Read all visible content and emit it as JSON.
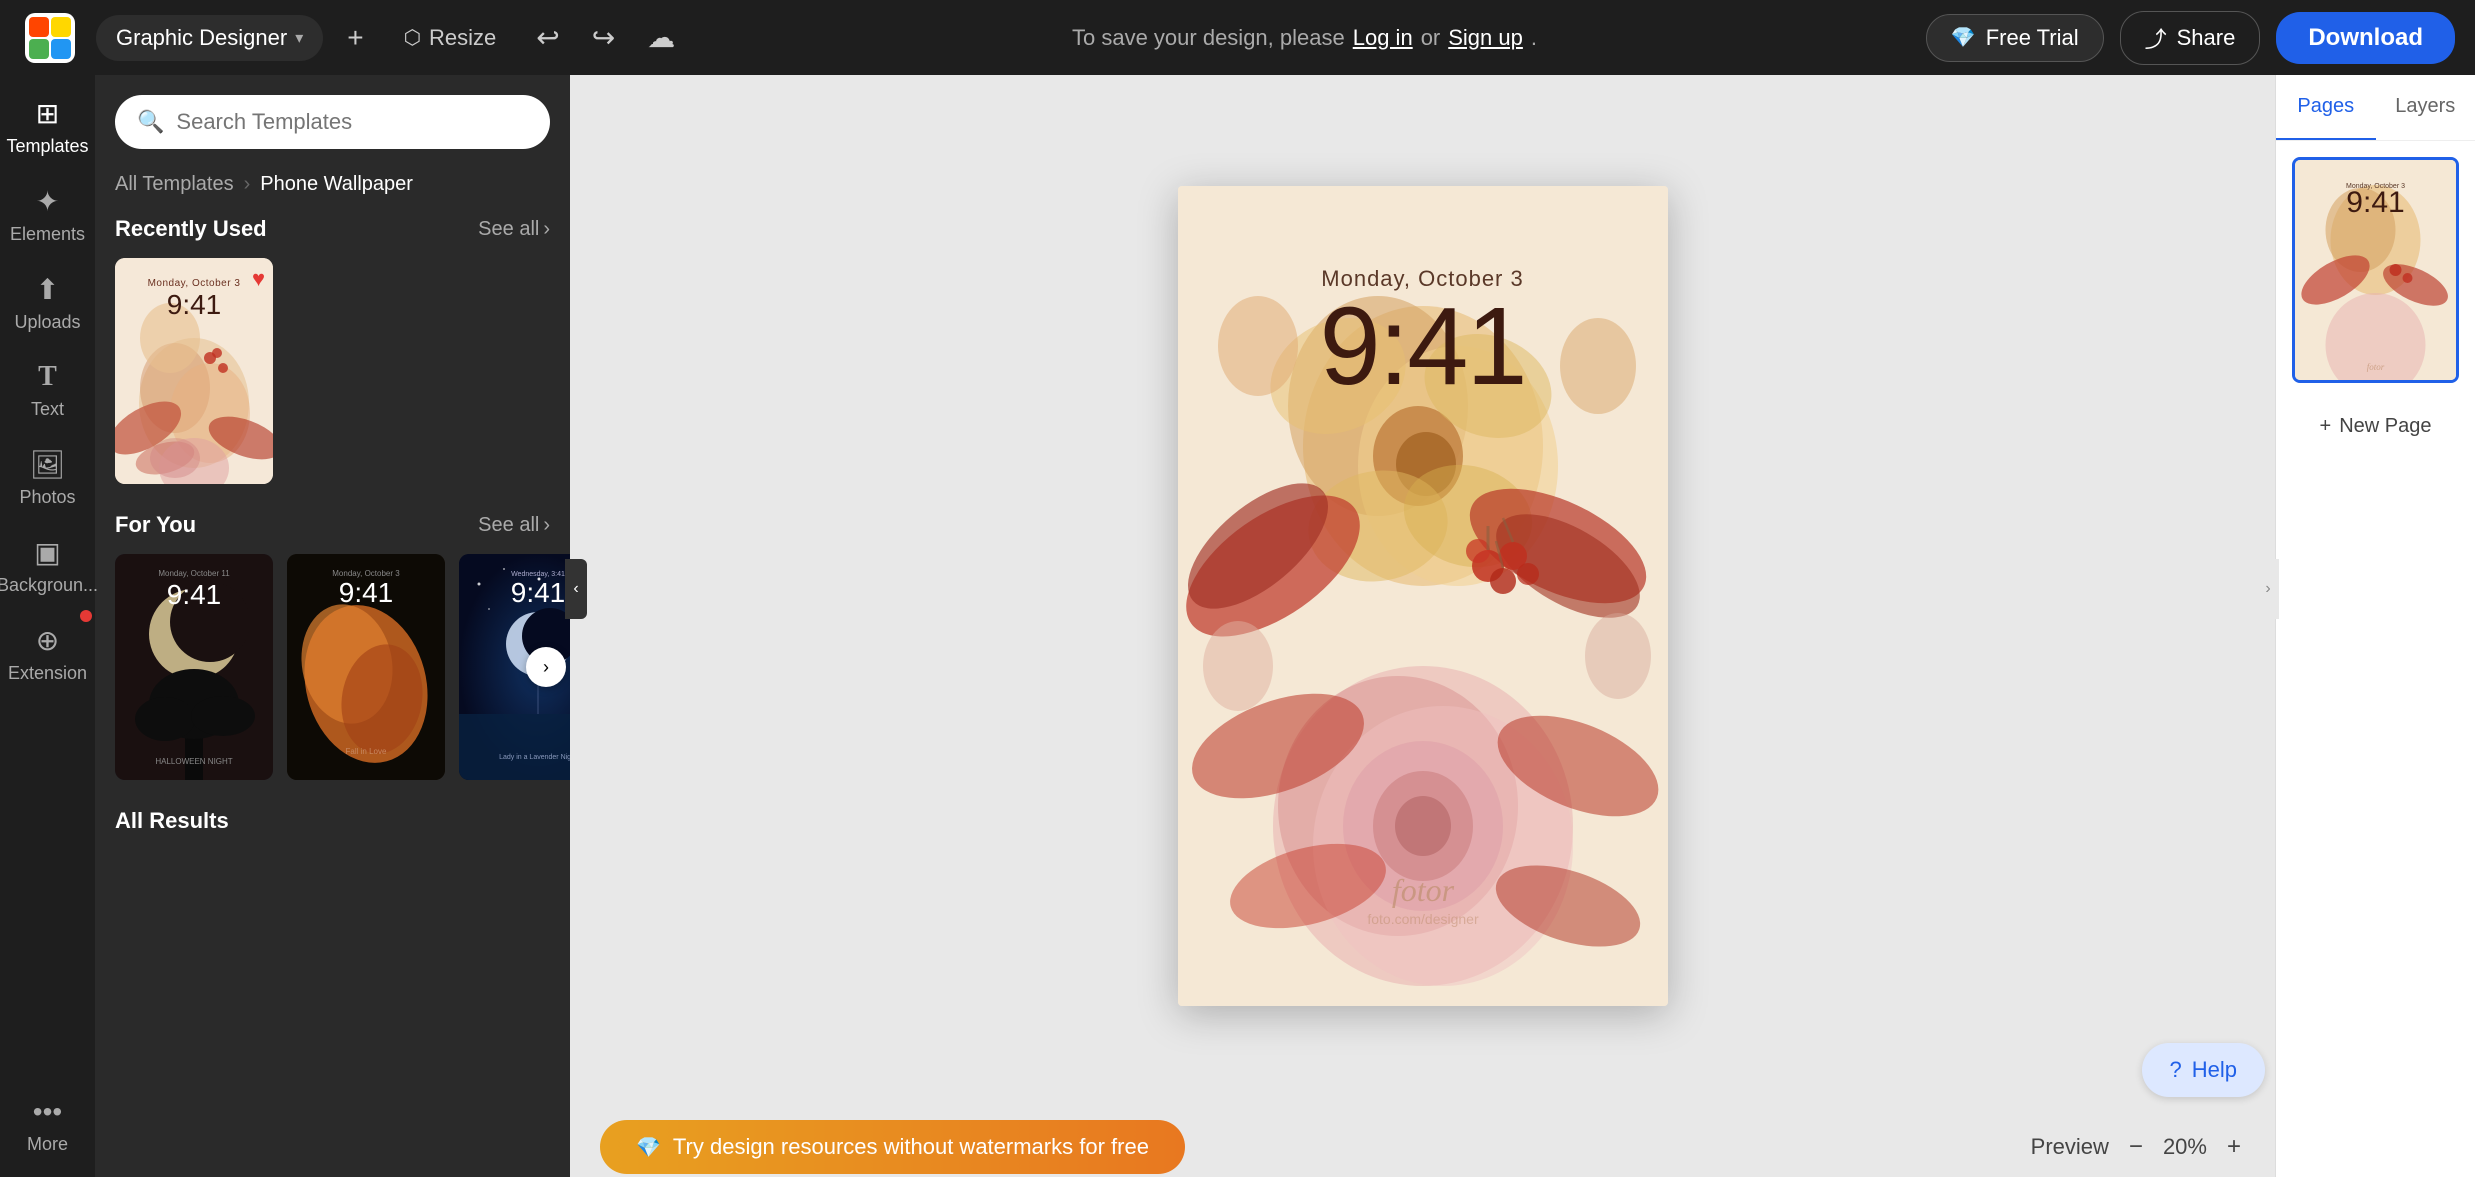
{
  "app": {
    "logo_text": "fotor",
    "title": "Graphic Designer"
  },
  "topbar": {
    "app_selector_label": "Graphic Designer",
    "resize_label": "Resize",
    "undo_label": "Undo",
    "redo_label": "Redo",
    "save_cloud_label": "Save to Cloud",
    "save_notice": "To save your design, please",
    "log_in": "Log in",
    "or": "or",
    "sign_up": "Sign up",
    "period": ".",
    "free_trial_label": "Free Trial",
    "share_label": "Share",
    "download_label": "Download"
  },
  "sidebar": {
    "items": [
      {
        "id": "templates",
        "icon": "⊞",
        "label": "Templates",
        "active": true
      },
      {
        "id": "elements",
        "icon": "✦",
        "label": "Elements"
      },
      {
        "id": "uploads",
        "icon": "↑",
        "label": "Uploads"
      },
      {
        "id": "text",
        "icon": "T",
        "label": "Text"
      },
      {
        "id": "photos",
        "icon": "🖼",
        "label": "Photos"
      },
      {
        "id": "backgrounds",
        "icon": "▣",
        "label": "Backgroun..."
      },
      {
        "id": "extension",
        "icon": "⊕",
        "label": "Extension",
        "badge": true
      },
      {
        "id": "more",
        "icon": "•••",
        "label": "More"
      }
    ]
  },
  "templates_panel": {
    "search_placeholder": "Search Templates",
    "breadcrumb_all": "All Templates",
    "breadcrumb_current": "Phone Wallpaper",
    "recently_used": "Recently Used",
    "for_you": "For You",
    "all_results": "All Results",
    "see_all": "See all"
  },
  "canvas": {
    "date": "Monday, October 3",
    "time": "9:41",
    "watermark": "fotor"
  },
  "right_panel": {
    "pages_tab": "Pages",
    "layers_tab": "Layers",
    "new_page_label": "+ New Page"
  },
  "bottom_bar": {
    "watermark_banner": "Try design resources without watermarks for free",
    "preview_label": "Preview",
    "zoom_value": "20%"
  },
  "help": {
    "label": "Help"
  }
}
